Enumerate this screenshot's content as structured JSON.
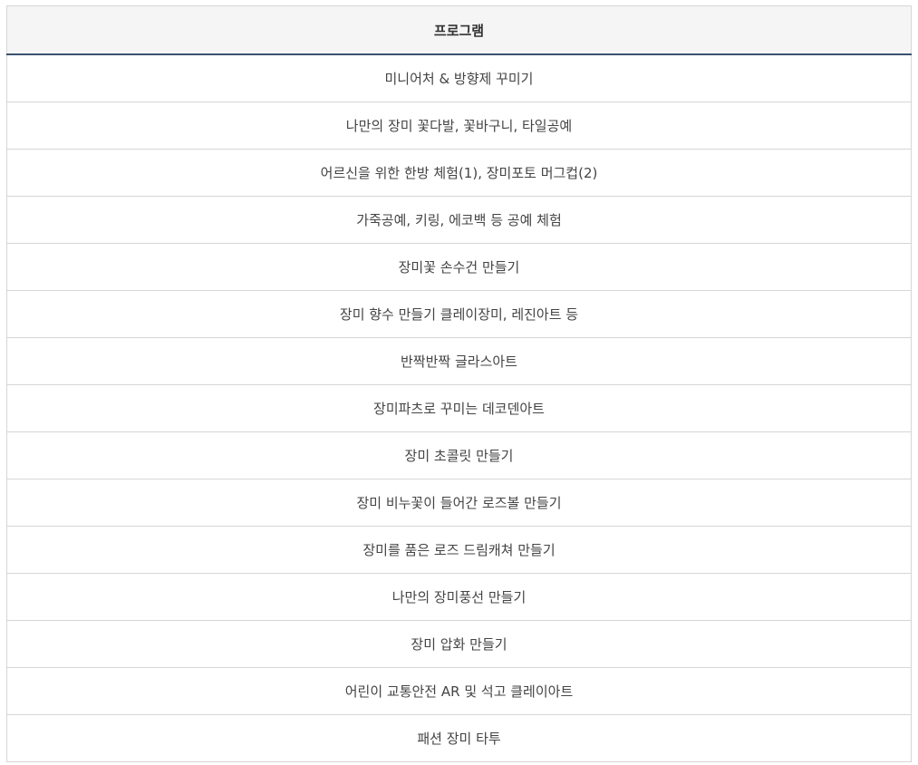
{
  "table": {
    "header": "프로그램",
    "rows": [
      "미니어처 & 방향제 꾸미기",
      "나만의 장미 꽃다발, 꽃바구니, 타일공예",
      "어르신을 위한 한방 체험(1), 장미포토 머그컵(2)",
      "가죽공예, 키링, 에코백 등 공예 체험",
      "장미꽃 손수건 만들기",
      "장미 향수 만들기 클레이장미, 레진아트 등",
      "반짝반짝 글라스아트",
      "장미파츠로 꾸미는 데코덴아트",
      "장미 초콜릿 만들기",
      "장미 비누꽃이 들어간 로즈볼 만들기",
      "장미를 품은 로즈 드림캐쳐 만들기",
      "나만의 장미풍선 만들기",
      "장미 압화 만들기",
      "어린이 교통안전 AR 및 석고 클레이아트",
      "패션 장미 타투"
    ]
  },
  "colors": {
    "header_bg": "#f5f5f5",
    "header_underline": "#3b5170",
    "border": "#d6d6d6"
  }
}
